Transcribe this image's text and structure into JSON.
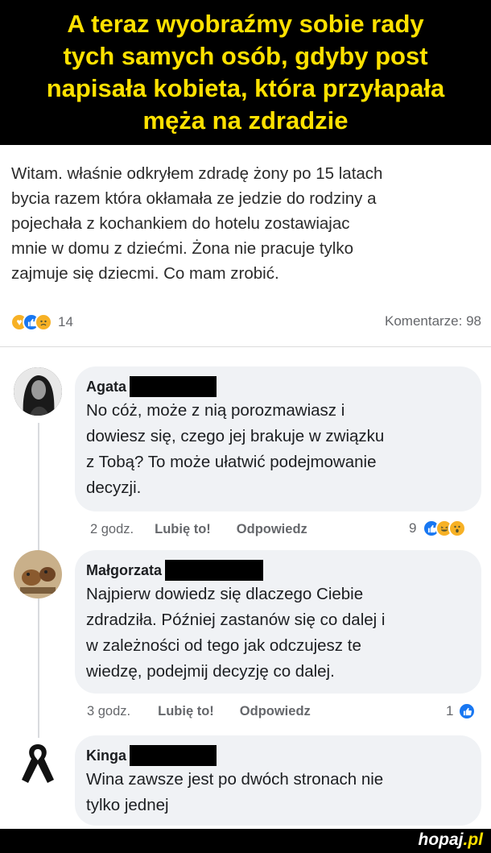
{
  "banner": {
    "lines": [
      "A teraz wyobraźmy sobie rady",
      "tych samych osób, gdyby post",
      "napisała kobieta, która przyłapała",
      "męża na zdradzie"
    ]
  },
  "post": {
    "lines": [
      "Witam. właśnie odkryłem zdradę żony po 15 latach",
      "bycia razem która okłamała  ze jedzie do rodziny a",
      "pojechała z kochankiem do hotelu zostawiajac",
      "mnie w domu z dziećmi. Żona nie pracuje tylko",
      "zajmuje się dziecmi. Co mam zrobić."
    ],
    "reaction_count": "14",
    "reaction_icons": [
      "care-icon",
      "like-icon",
      "sad-icon"
    ],
    "comments_label": "Komentarze: 98"
  },
  "comments": [
    {
      "author": "Agata",
      "lines": [
        "No cóż, może z nią porozmawiasz i",
        "dowiesz się, czego jej brakuje w związku",
        "z Tobą? To może ułatwić podejmowanie",
        "decyzji."
      ],
      "time": "2 godz.",
      "like": "Lubię to!",
      "reply": "Odpowiedz",
      "reaction_count": "9",
      "reaction_icons": [
        "like-icon",
        "haha-icon",
        "wow-icon"
      ]
    },
    {
      "author": "Małgorzata",
      "lines": [
        "Najpierw dowiedz się dlaczego Ciebie",
        "zdradziła. Później zastanów się co dalej i",
        "w zależności od tego jak odczujesz te",
        "wiedzę, podejmij decyzję co dalej."
      ],
      "time": "3 godz.",
      "like": "Lubię to!",
      "reply": "Odpowiedz",
      "reaction_count": "1",
      "reaction_icons": [
        "like-icon"
      ]
    },
    {
      "author": "Kinga",
      "lines": [
        "Wina zawsze jest po dwóch stronach nie",
        "tylko jednej"
      ]
    }
  ],
  "footer": {
    "logo_main": "hopaj",
    "logo_tld": ".pl"
  }
}
